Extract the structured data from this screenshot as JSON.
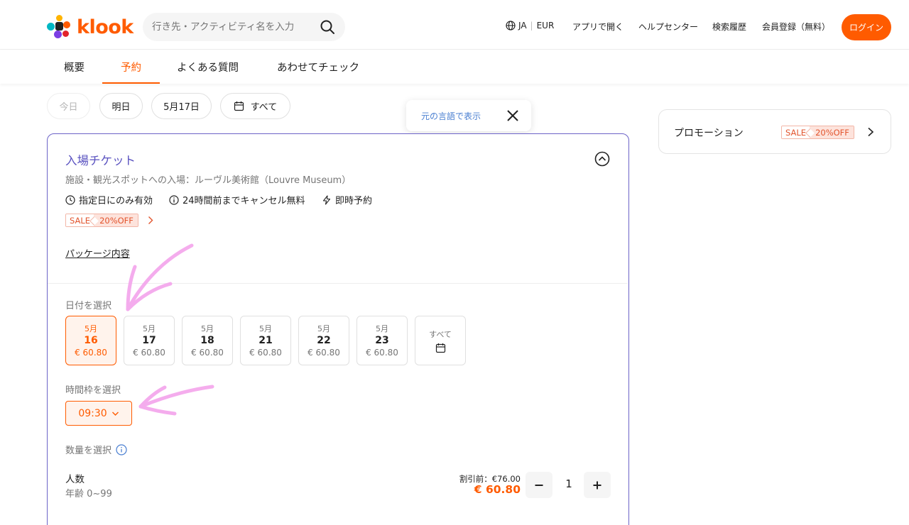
{
  "colors": {
    "accent": "#ff5b00",
    "title_purple": "#5a52c0",
    "link_blue": "#4a7fd1",
    "annotation_pink": "#f4a6ec"
  },
  "header": {
    "logo_text": "klook",
    "search_placeholder": "行き先・アクティビティ名を入力",
    "lang": "JA",
    "currency": "EUR",
    "nav": [
      "アプリで開く",
      "ヘルプセンター",
      "検索履歴",
      "会員登録（無料）"
    ],
    "login": "ログイン"
  },
  "tabs": [
    "概要",
    "予約",
    "よくある質問",
    "あわせてチェック"
  ],
  "active_tab": "予約",
  "date_chips": [
    "今日",
    "明日",
    "5月17日",
    "すべて"
  ],
  "translate_popup": {
    "link": "元の言語で表示"
  },
  "promotion": {
    "title": "プロモーション",
    "sale": "SALE",
    "discount": "20%OFF"
  },
  "package": {
    "title": "入場チケット",
    "subtitle": "施設・観光スポットへの入場：ルーヴル美術館（Louvre Museum）",
    "features": [
      "指定日にのみ有効",
      "24時間前までキャンセル無料",
      "即時予約"
    ],
    "sale": "SALE",
    "discount": "20%OFF",
    "details_link": "パッケージ内容",
    "date_label": "日付を選択",
    "dates": [
      {
        "month": "5月",
        "day": "16",
        "price": "€ 60.80"
      },
      {
        "month": "5月",
        "day": "17",
        "price": "€ 60.80"
      },
      {
        "month": "5月",
        "day": "18",
        "price": "€ 60.80"
      },
      {
        "month": "5月",
        "day": "21",
        "price": "€ 60.80"
      },
      {
        "month": "5月",
        "day": "22",
        "price": "€ 60.80"
      },
      {
        "month": "5月",
        "day": "23",
        "price": "€ 60.80"
      }
    ],
    "dates_all": "すべて",
    "time_label": "時間枠を選択",
    "time_value": "09:30",
    "qty_label": "数量を選択",
    "person_label": "人数",
    "person_age": "年齢 0~99",
    "original_price": "割引前：€76.00",
    "price": "€ 60.80",
    "quantity": "1"
  }
}
